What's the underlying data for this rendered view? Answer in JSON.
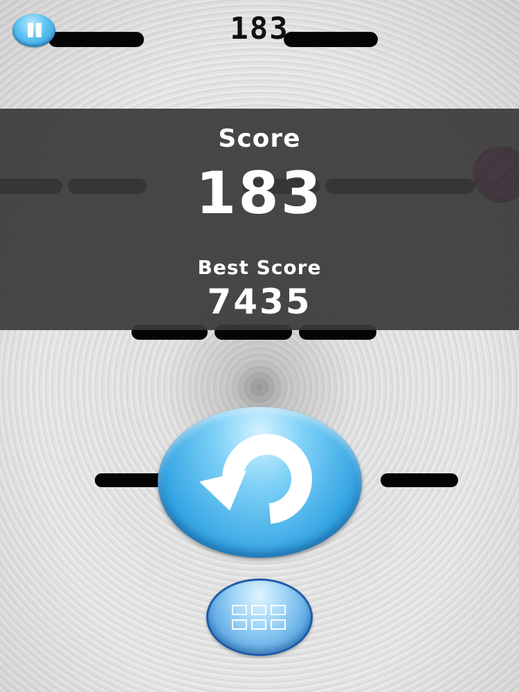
{
  "hud": {
    "current_score": "183",
    "pause_icon": "pause-icon"
  },
  "game_over": {
    "score_label": "Score",
    "score_value": "183",
    "best_label": "Best Score",
    "best_value": "7435"
  },
  "buttons": {
    "restart_icon": "restart-arrow-icon",
    "levels_icon": "grid-menu-icon"
  },
  "colors": {
    "button_blue": "#36a6e4",
    "panel_overlay": "#3a3a3a",
    "bar_black": "#050505",
    "ball_magenta": "#b01c7c"
  }
}
